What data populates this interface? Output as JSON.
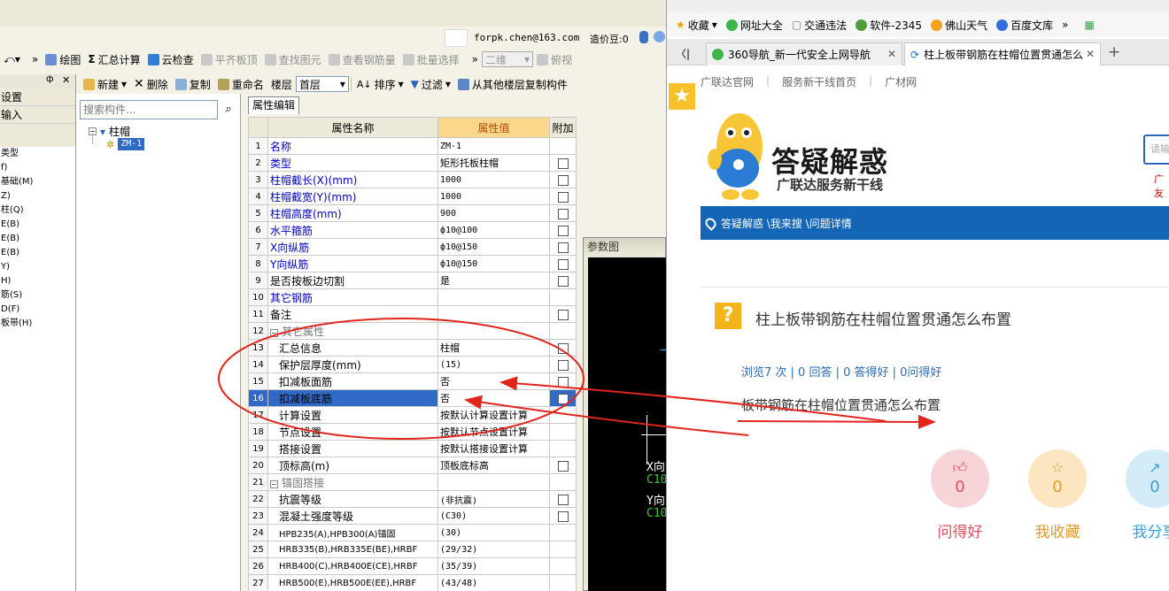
{
  "colors": {
    "annotation_red": "#e1251b",
    "selection_blue": "#3169c6",
    "header_highlight": "#fbd78c",
    "crumb_blue": "#1565b7",
    "like_pink": "#f7d4d7",
    "fav_yellow": "#fbe6c1",
    "share_blue": "#d3ecf8"
  },
  "app": {
    "user_email": "forpk.chen@163.com",
    "price_label": "造价豆:0",
    "toolbar1": {
      "chevron": "»",
      "draw": "绘图",
      "sum_calc": "汇总计算",
      "cloud_check": "云检查",
      "level_slab": "平齐板顶",
      "find_elem": "查找图元",
      "view_rebar": "查看钢筋量",
      "batch_select": "批量选择",
      "chevron2": "»",
      "view_2d": "二维",
      "view_top": "俯视"
    },
    "toolbar2": {
      "new": "新建",
      "delete": "删除",
      "copy": "复制",
      "rename": "重命名",
      "floor_label": "楼层",
      "floor_value": "首层",
      "sort": "排序",
      "filter": "过滤",
      "copy_from_floor": "从其他楼层复制构件"
    },
    "left_panel": {
      "rows": [
        "设置",
        "输入"
      ],
      "small_items": [
        "类型",
        "f)",
        "基础(M)",
        "Z)",
        "柱(Q)",
        "",
        "E(B)",
        "",
        "",
        "",
        "",
        "",
        "",
        "E(B)",
        "E(B)",
        "Y)",
        "H)",
        "筋(S)",
        "D(F)",
        "板带(H)"
      ]
    },
    "tree": {
      "search_placeholder": "搜索构件...",
      "root": "柱帽",
      "child": "ZM-1"
    },
    "prop_tab": "属性编辑",
    "prop_headers": {
      "name": "属性名称",
      "value": "属性值",
      "extra": "附加"
    },
    "prop_rows": [
      {
        "no": "1",
        "name": "名称",
        "value": "ZM-1",
        "check": false,
        "style": "blue"
      },
      {
        "no": "2",
        "name": "类型",
        "value": "矩形托板柱帽",
        "check": true,
        "style": "blue"
      },
      {
        "no": "3",
        "name": "柱帽截长(X)(mm)",
        "value": "1000",
        "check": true,
        "style": "blue"
      },
      {
        "no": "4",
        "name": "柱帽截宽(Y)(mm)",
        "value": "1000",
        "check": true,
        "style": "blue"
      },
      {
        "no": "5",
        "name": "柱帽高度(mm)",
        "value": "900",
        "check": true,
        "style": "blue"
      },
      {
        "no": "6",
        "name": "水平箍筋",
        "value": "ф10@100",
        "check": true,
        "style": "blue"
      },
      {
        "no": "7",
        "name": "X向纵筋",
        "value": "ф10@150",
        "check": true,
        "style": "blue"
      },
      {
        "no": "8",
        "name": "Y向纵筋",
        "value": "ф10@150",
        "check": true,
        "style": "blue"
      },
      {
        "no": "9",
        "name": "是否按板边切割",
        "value": "是",
        "check": true,
        "style": "black"
      },
      {
        "no": "10",
        "name": "其它钢筋",
        "value": "",
        "check": false,
        "style": "blue"
      },
      {
        "no": "11",
        "name": "备注",
        "value": "",
        "check": true,
        "style": "black"
      },
      {
        "no": "12",
        "name": "其它属性",
        "value": "",
        "check": false,
        "style": "group"
      },
      {
        "no": "13",
        "name": "汇总信息",
        "value": "柱帽",
        "check": true,
        "style": "sub"
      },
      {
        "no": "14",
        "name": "保护层厚度(mm)",
        "value": "(15)",
        "check": true,
        "style": "sub"
      },
      {
        "no": "15",
        "name": "扣减板面筋",
        "value": "否",
        "check": true,
        "style": "sub"
      },
      {
        "no": "16",
        "name": "扣减板底筋",
        "value": "否",
        "check": true,
        "style": "selected"
      },
      {
        "no": "17",
        "name": "计算设置",
        "value": "按默认计算设置计算",
        "check": false,
        "style": "sub"
      },
      {
        "no": "18",
        "name": "节点设置",
        "value": "按默认节点设置计算",
        "check": false,
        "style": "sub"
      },
      {
        "no": "19",
        "name": "搭接设置",
        "value": "按默认搭接设置计算",
        "check": false,
        "style": "sub"
      },
      {
        "no": "20",
        "name": "顶标高(m)",
        "value": "顶板底标高",
        "check": true,
        "style": "sub"
      },
      {
        "no": "21",
        "name": "锚固搭接",
        "value": "",
        "check": false,
        "style": "group"
      },
      {
        "no": "22",
        "name": "抗震等级",
        "value": "(非抗震)",
        "check": true,
        "style": "sub"
      },
      {
        "no": "23",
        "name": "混凝土强度等级",
        "value": "(C30)",
        "check": true,
        "style": "sub"
      },
      {
        "no": "24",
        "name": "HPB235(A),HPB300(A)锚固",
        "value": "(30)",
        "check": false,
        "style": "sub2"
      },
      {
        "no": "25",
        "name": "HRB335(B),HRB335E(BE),HRBF",
        "value": "(29/32)",
        "check": false,
        "style": "sub2"
      },
      {
        "no": "26",
        "name": "HRB400(C),HRB400E(CE),HRBF",
        "value": "(35/39)",
        "check": false,
        "style": "sub2"
      },
      {
        "no": "27",
        "name": "HRB500(E),HRB500E(EE),HRBF",
        "value": "(43/48)",
        "check": false,
        "style": "sub2"
      }
    ],
    "param_panel": {
      "title": "参数图",
      "x_label": "X向",
      "x_code": "C10",
      "y_label": "Y向",
      "y_code": "C10"
    }
  },
  "browser": {
    "bookmarks": [
      "收藏",
      "网址大全",
      "交通违法",
      "软件-2345",
      "佛山天气",
      "百度文库"
    ],
    "bookmarks_more": "»",
    "tabs": [
      {
        "title": "360导航_新一代安全上网导航",
        "active": false
      },
      {
        "title": "柱上板带钢筋在柱帽位置贯通怎么",
        "active": true
      }
    ],
    "new_tab": "+",
    "back": "〈|",
    "site_nav": [
      "广联达官网",
      "|",
      "服务新干线首页",
      "|",
      "广材网"
    ],
    "site_brand": "答疑解惑",
    "site_slogan": "广联达服务新干线",
    "search_placeholder": "请输",
    "search_note": "广友",
    "breadcrumb": "答疑解惑 \\我来搜 \\问题详情",
    "question_title": "柱上板带钢筋在柱帽位置贯通怎么布置",
    "question_stats": "浏览7 次 | 0 回答 | 0 答得好 | 0问得好",
    "question_body": "板带钢筋在柱帽位置贯通怎么布置",
    "actions": [
      {
        "label": "问得好",
        "count": "0",
        "icon": "thumb-up-icon"
      },
      {
        "label": "我收藏",
        "count": "0",
        "icon": "star-icon"
      },
      {
        "label": "我分享",
        "count": "0",
        "icon": "share-icon"
      }
    ]
  }
}
